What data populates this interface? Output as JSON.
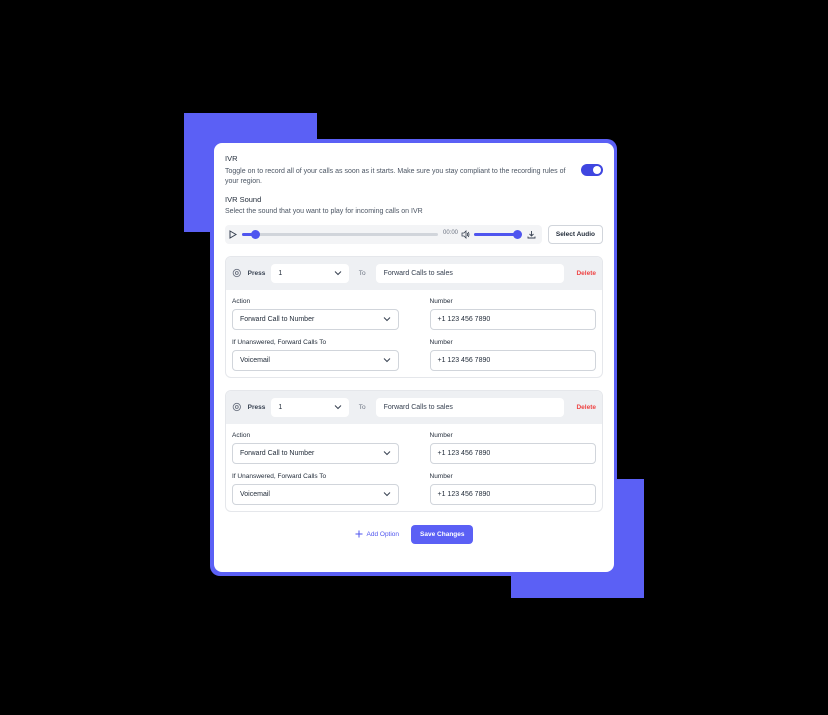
{
  "ivr": {
    "title": "IVR",
    "description": "Toggle on to record all of your calls as soon as it starts. Make sure you stay compliant to the recording rules of your region.",
    "toggle_on": true
  },
  "sound": {
    "title": "IVR Sound",
    "description": "Select the sound that you want to play for incoming calls on IVR",
    "time": "00:00",
    "progress": 0.07,
    "volume": 0.95,
    "select_label": "Select Audio"
  },
  "options": [
    {
      "press_label": "Press",
      "press_value": "1",
      "to_label": "To",
      "forward_value": "Forward Calls to sales",
      "delete_label": "Delete",
      "action_label": "Action",
      "action_value": "Forward Call to Number",
      "number_label": "Number",
      "number_value": "+1 123 456 7890",
      "unanswered_label": "If Unanswered, Forward Calls To",
      "unanswered_value": "Voicemail",
      "number2_label": "Number",
      "number2_value": "+1 123 456 7890"
    },
    {
      "press_label": "Press",
      "press_value": "1",
      "to_label": "To",
      "forward_value": "Forward Calls to sales",
      "delete_label": "Delete",
      "action_label": "Action",
      "action_value": "Forward Call to Number",
      "number_label": "Number",
      "number_value": "+1 123 456 7890",
      "unanswered_label": "If Unanswered, Forward Calls To",
      "unanswered_value": "Voicemail",
      "number2_label": "Number",
      "number2_value": "+1 123 456 7890"
    }
  ],
  "footer": {
    "add_label": "Add Option",
    "save_label": "Save Changes"
  },
  "colors": {
    "accent": "#5b60f5",
    "danger": "#ef4444"
  },
  "icons": [
    "play-icon",
    "volume-icon",
    "download-icon",
    "gear-icon",
    "chevron-down-icon",
    "plus-icon"
  ]
}
